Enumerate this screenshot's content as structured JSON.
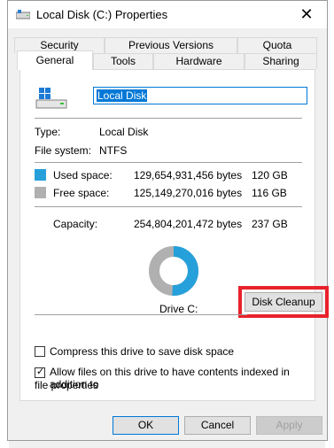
{
  "window": {
    "title": "Local Disk (C:) Properties",
    "close_icon": "close-icon"
  },
  "tabs_row1": [
    {
      "label": "Security"
    },
    {
      "label": "Previous Versions"
    },
    {
      "label": "Quota"
    }
  ],
  "tabs_row2": [
    {
      "label": "General",
      "active": true
    },
    {
      "label": "Tools"
    },
    {
      "label": "Hardware"
    },
    {
      "label": "Sharing"
    }
  ],
  "general": {
    "drive_name": "Local Disk",
    "type_label": "Type:",
    "type_value": "Local Disk",
    "fs_label": "File system:",
    "fs_value": "NTFS",
    "used_label": "Used space:",
    "used_bytes": "129,654,931,456 bytes",
    "used_gb": "120 GB",
    "free_label": "Free space:",
    "free_bytes": "125,149,270,016 bytes",
    "free_gb": "116 GB",
    "capacity_label": "Capacity:",
    "capacity_bytes": "254,804,201,472 bytes",
    "capacity_gb": "237 GB",
    "drive_label": "Drive C:",
    "disk_cleanup_label": "Disk Cleanup",
    "compress_label": "Compress this drive to save disk space",
    "compress_checked": false,
    "index_label": "Allow files on this drive to have contents indexed in addition to",
    "index_label_line2": "file properties",
    "index_checked": true
  },
  "colors": {
    "used": "#26a0da",
    "free": "#b0b0b0",
    "highlight": "#e8222b",
    "accent": "#0078d7"
  },
  "usage_fraction_used": 0.509,
  "buttons": {
    "ok": "OK",
    "cancel": "Cancel",
    "apply": "Apply"
  }
}
